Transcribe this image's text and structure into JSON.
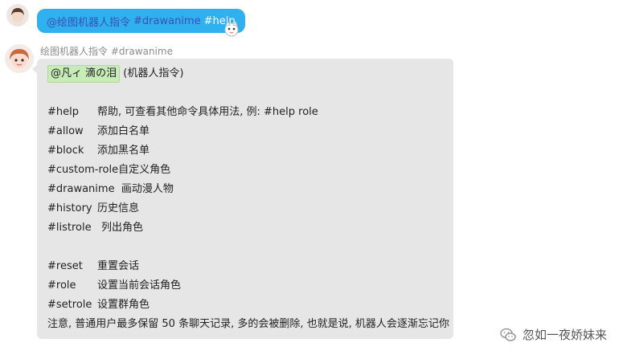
{
  "outgoing": {
    "mention": "@绘图机器人指令",
    "command": "#drawanime",
    "help": "#help"
  },
  "incoming": {
    "sender": "绘图机器人指令 #drawanime",
    "mention": "@凡ィ 滴の泪",
    "mention_suffix": " (机器人指令)",
    "commands": [
      {
        "cmd": "#help",
        "desc": "帮助, 可查看其他命令具体用法, 例: #help role"
      },
      {
        "cmd": "#allow",
        "desc": "添加白名单"
      },
      {
        "cmd": "#block",
        "desc": "添加黑名单"
      },
      {
        "cmd": "#custom-role",
        "desc": "自定义角色"
      },
      {
        "cmd": "#drawanime",
        "desc": "画动漫人物"
      },
      {
        "cmd": "#history",
        "desc": "历史信息"
      },
      {
        "cmd": "#listrole",
        "desc": "列出角色"
      }
    ],
    "commands2": [
      {
        "cmd": "#reset",
        "desc": "重置会话"
      },
      {
        "cmd": "#role",
        "desc": "设置当前会话角色"
      },
      {
        "cmd": "#setrole",
        "desc": "设置群角色"
      }
    ],
    "notice": "注意, 普通用户最多保留 50 条聊天记录, 多的会被删除, 也就是说, 机器人会逐渐忘记你"
  },
  "watermark": {
    "text": "忽如一夜娇妹来"
  },
  "colors": {
    "outgoing_bubble": "#2fb0ef",
    "incoming_bubble": "#e6e6e6",
    "mention_chip": "#c9ebb7"
  }
}
